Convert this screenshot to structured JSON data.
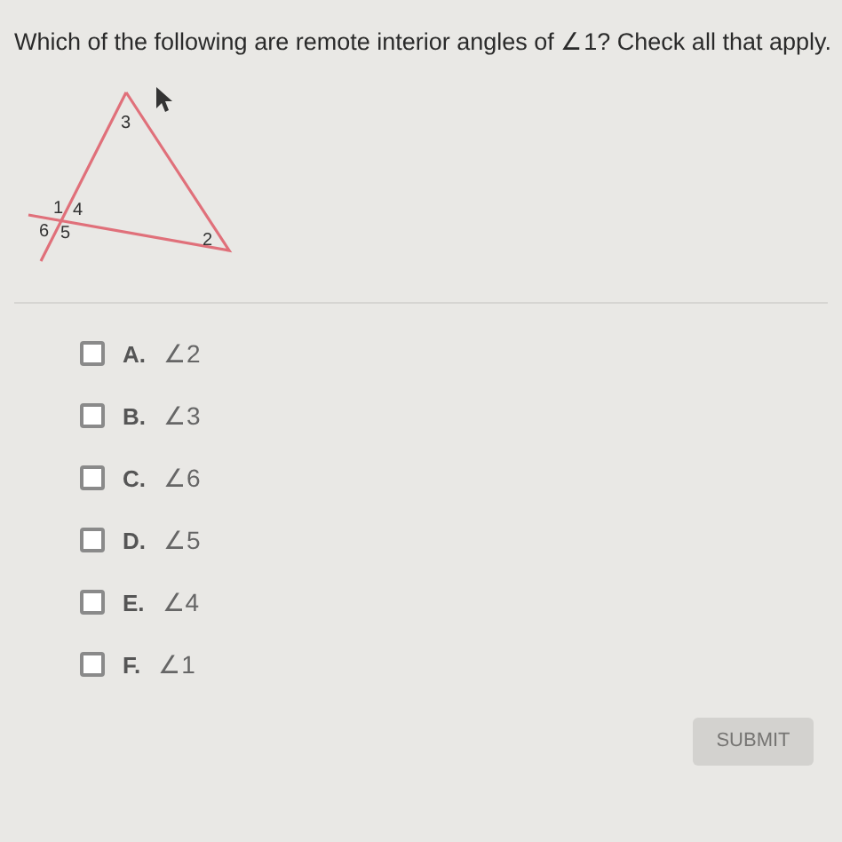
{
  "question": "Which of the following are remote interior angles of ∠1? Check all that apply.",
  "diagram": {
    "labels": [
      "3",
      "1",
      "4",
      "6",
      "5",
      "2"
    ]
  },
  "options": [
    {
      "letter": "A.",
      "text": "∠2",
      "checked": false
    },
    {
      "letter": "B.",
      "text": "∠3",
      "checked": false
    },
    {
      "letter": "C.",
      "text": "∠6",
      "checked": false
    },
    {
      "letter": "D.",
      "text": "∠5",
      "checked": false
    },
    {
      "letter": "E.",
      "text": "∠4",
      "checked": false
    },
    {
      "letter": "F.",
      "text": "∠1",
      "checked": false
    }
  ],
  "submit": {
    "label": "SUBMIT",
    "disabled": true
  }
}
